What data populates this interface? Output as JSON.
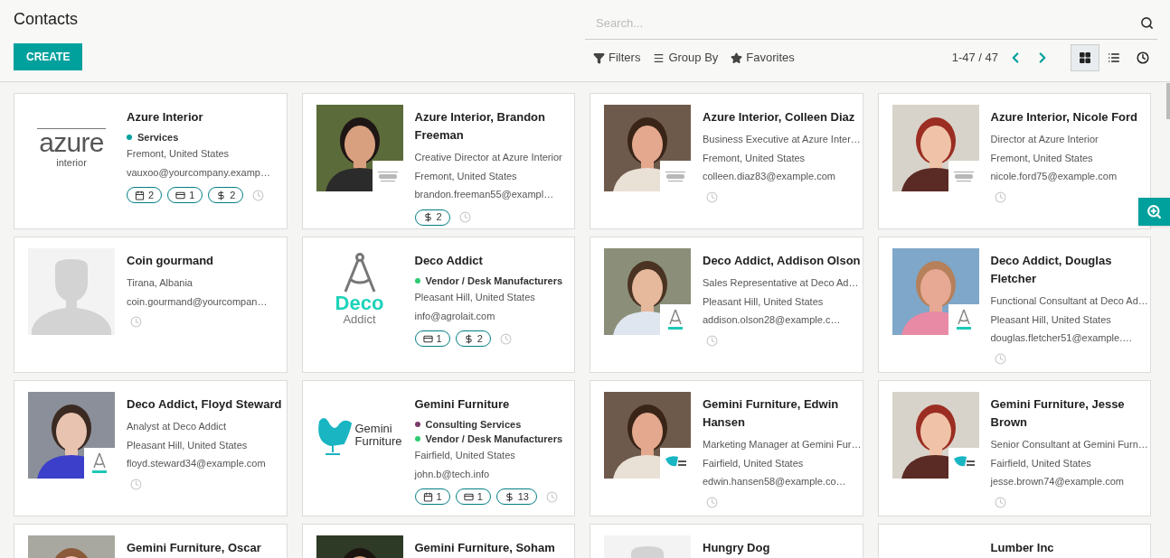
{
  "title": "Contacts",
  "create_button": "CREATE",
  "search": {
    "placeholder": "Search..."
  },
  "filters": [
    {
      "kind": "filter",
      "label": "Filters"
    },
    {
      "kind": "group",
      "label": "Group By"
    },
    {
      "kind": "favorite",
      "label": "Favorites"
    }
  ],
  "pager": "1-47 / 47",
  "views": [
    {
      "kind": "kanban",
      "selected": true
    },
    {
      "kind": "list",
      "selected": false
    },
    {
      "kind": "activity",
      "selected": false
    }
  ],
  "cards": [
    {
      "name": "Azure Interior",
      "image": {
        "kind": "logo-azure",
        "logo_text": [
          "azure",
          "interior"
        ]
      },
      "tags": [
        {
          "label": "Services",
          "color": "#00a09d"
        }
      ],
      "lines": [
        "Fremont, United States",
        "vauxoo@yourcompany.examp…"
      ],
      "badges": [
        {
          "kind": "calendar",
          "count": "2"
        },
        {
          "kind": "card",
          "count": "1"
        },
        {
          "kind": "dollar",
          "count": "2"
        }
      ],
      "activity": true
    },
    {
      "name": "Azure Interior, Brandon Freeman",
      "image": {
        "kind": "picture",
        "company_logo": {
          "kind": "azure"
        }
      },
      "lines": [
        "Creative Director at Azure Interior",
        "Fremont, United States",
        "brandon.freeman55@exampl…"
      ],
      "badges": [
        {
          "kind": "dollar",
          "count": "2"
        }
      ],
      "activity": true
    },
    {
      "name": "Azure Interior, Colleen Diaz",
      "image": {
        "kind": "picture",
        "company_logo": {
          "kind": "azure"
        }
      },
      "lines": [
        "Business Executive at Azure Inter…",
        "Fremont, United States",
        "colleen.diaz83@example.com"
      ],
      "activity": true
    },
    {
      "name": "Azure Interior, Nicole Ford",
      "image": {
        "kind": "picture",
        "company_logo": {
          "kind": "azure"
        }
      },
      "lines": [
        "Director at Azure Interior",
        "Fremont, United States",
        "nicole.ford75@example.com"
      ],
      "activity": true
    },
    {
      "name": "Coin gourmand",
      "image": {
        "kind": "placeholder"
      },
      "lines": [
        "Tirana, Albania",
        "coin.gourmand@yourcompan…"
      ],
      "activity": true
    },
    {
      "name": "Deco Addict",
      "image": {
        "kind": "logo-deco",
        "logo_text": [
          "Deco",
          "Addict"
        ]
      },
      "tags": [
        {
          "label": "Vendor / Desk Manufacturers",
          "color": "#2ecc71"
        }
      ],
      "lines": [
        "Pleasant Hill, United States",
        "info@agrolait.com"
      ],
      "badges": [
        {
          "kind": "card",
          "count": "1"
        },
        {
          "kind": "dollar",
          "count": "2"
        }
      ],
      "activity": true
    },
    {
      "name": "Deco Addict, Addison Olson",
      "image": {
        "kind": "picture",
        "company_logo": {
          "kind": "deco"
        }
      },
      "lines": [
        "Sales Representative at Deco Ad…",
        "Pleasant Hill, United States",
        "addison.olson28@example.c…"
      ],
      "activity": true
    },
    {
      "name": "Deco Addict, Douglas Fletcher",
      "image": {
        "kind": "picture",
        "company_logo": {
          "kind": "deco"
        }
      },
      "lines": [
        "Functional Consultant at Deco Ad…",
        "Pleasant Hill, United States",
        "douglas.fletcher51@example.…"
      ],
      "activity": true
    },
    {
      "name": "Deco Addict, Floyd Steward",
      "image": {
        "kind": "picture",
        "company_logo": {
          "kind": "deco"
        }
      },
      "lines": [
        "Analyst at Deco Addict",
        "Pleasant Hill, United States",
        "floyd.steward34@example.com"
      ],
      "activity": true
    },
    {
      "name": "Gemini Furniture",
      "image": {
        "kind": "logo-gemini",
        "logo_text": [
          "Gemini",
          "Furniture"
        ]
      },
      "tags": [
        {
          "label": "Consulting Services",
          "color": "#7c3a6a"
        },
        {
          "label": "Vendor / Desk Manufacturers",
          "color": "#2ecc71"
        }
      ],
      "lines": [
        "Fairfield, United States",
        "john.b@tech.info"
      ],
      "badges": [
        {
          "kind": "calendar",
          "count": "1"
        },
        {
          "kind": "card",
          "count": "1"
        },
        {
          "kind": "dollar",
          "count": "13"
        }
      ],
      "activity": true
    },
    {
      "name": "Gemini Furniture, Edwin Hansen",
      "image": {
        "kind": "picture",
        "company_logo": {
          "kind": "gemini"
        }
      },
      "lines": [
        "Marketing Manager at Gemini Fur…",
        "Fairfield, United States",
        "edwin.hansen58@example.co…"
      ],
      "activity": true
    },
    {
      "name": "Gemini Furniture, Jesse Brown",
      "image": {
        "kind": "picture",
        "company_logo": {
          "kind": "gemini"
        }
      },
      "lines": [
        "Senior Consultant at Gemini Furn…",
        "Fairfield, United States",
        "jesse.brown74@example.com"
      ],
      "activity": true
    },
    {
      "name": "Gemini Furniture, Oscar"
    },
    {
      "name": "Gemini Furniture, Soham"
    },
    {
      "name": "Hungry Dog",
      "image": {
        "kind": "placeholder"
      }
    },
    {
      "name": "Lumber Inc"
    }
  ]
}
